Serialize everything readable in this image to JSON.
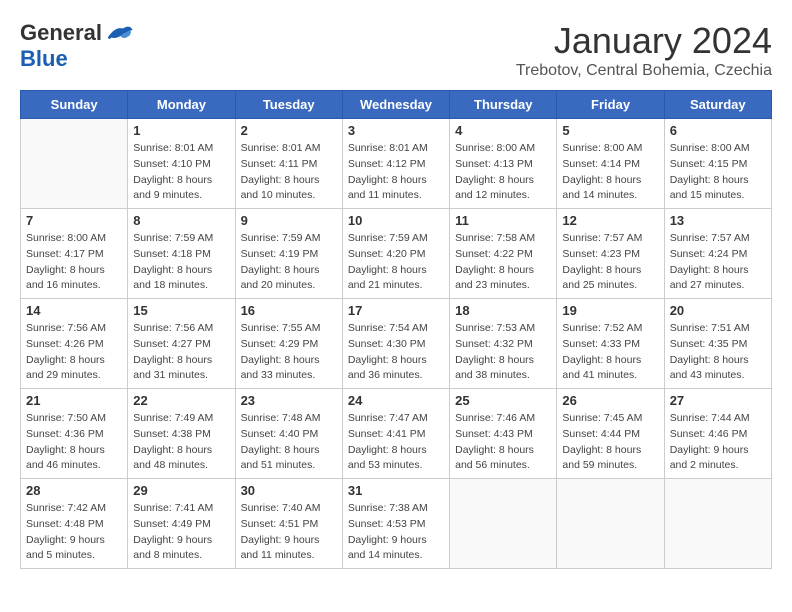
{
  "header": {
    "logo_general": "General",
    "logo_blue": "Blue",
    "month_title": "January 2024",
    "location": "Trebotov, Central Bohemia, Czechia"
  },
  "days_of_week": [
    "Sunday",
    "Monday",
    "Tuesday",
    "Wednesday",
    "Thursday",
    "Friday",
    "Saturday"
  ],
  "weeks": [
    [
      {
        "day": "",
        "info": ""
      },
      {
        "day": "1",
        "info": "Sunrise: 8:01 AM\nSunset: 4:10 PM\nDaylight: 8 hours\nand 9 minutes."
      },
      {
        "day": "2",
        "info": "Sunrise: 8:01 AM\nSunset: 4:11 PM\nDaylight: 8 hours\nand 10 minutes."
      },
      {
        "day": "3",
        "info": "Sunrise: 8:01 AM\nSunset: 4:12 PM\nDaylight: 8 hours\nand 11 minutes."
      },
      {
        "day": "4",
        "info": "Sunrise: 8:00 AM\nSunset: 4:13 PM\nDaylight: 8 hours\nand 12 minutes."
      },
      {
        "day": "5",
        "info": "Sunrise: 8:00 AM\nSunset: 4:14 PM\nDaylight: 8 hours\nand 14 minutes."
      },
      {
        "day": "6",
        "info": "Sunrise: 8:00 AM\nSunset: 4:15 PM\nDaylight: 8 hours\nand 15 minutes."
      }
    ],
    [
      {
        "day": "7",
        "info": ""
      },
      {
        "day": "8",
        "info": "Sunrise: 7:59 AM\nSunset: 4:18 PM\nDaylight: 8 hours\nand 18 minutes."
      },
      {
        "day": "9",
        "info": "Sunrise: 7:59 AM\nSunset: 4:19 PM\nDaylight: 8 hours\nand 20 minutes."
      },
      {
        "day": "10",
        "info": "Sunrise: 7:59 AM\nSunset: 4:20 PM\nDaylight: 8 hours\nand 21 minutes."
      },
      {
        "day": "11",
        "info": "Sunrise: 7:58 AM\nSunset: 4:22 PM\nDaylight: 8 hours\nand 23 minutes."
      },
      {
        "day": "12",
        "info": "Sunrise: 7:57 AM\nSunset: 4:23 PM\nDaylight: 8 hours\nand 25 minutes."
      },
      {
        "day": "13",
        "info": "Sunrise: 7:57 AM\nSunset: 4:24 PM\nDaylight: 8 hours\nand 27 minutes."
      }
    ],
    [
      {
        "day": "14",
        "info": ""
      },
      {
        "day": "15",
        "info": "Sunrise: 7:56 AM\nSunset: 4:27 PM\nDaylight: 8 hours\nand 31 minutes."
      },
      {
        "day": "16",
        "info": "Sunrise: 7:55 AM\nSunset: 4:29 PM\nDaylight: 8 hours\nand 33 minutes."
      },
      {
        "day": "17",
        "info": "Sunrise: 7:54 AM\nSunset: 4:30 PM\nDaylight: 8 hours\nand 36 minutes."
      },
      {
        "day": "18",
        "info": "Sunrise: 7:53 AM\nSunset: 4:32 PM\nDaylight: 8 hours\nand 38 minutes."
      },
      {
        "day": "19",
        "info": "Sunrise: 7:52 AM\nSunset: 4:33 PM\nDaylight: 8 hours\nand 41 minutes."
      },
      {
        "day": "20",
        "info": "Sunrise: 7:51 AM\nSunset: 4:35 PM\nDaylight: 8 hours\nand 43 minutes."
      }
    ],
    [
      {
        "day": "21",
        "info": ""
      },
      {
        "day": "22",
        "info": "Sunrise: 7:49 AM\nSunset: 4:38 PM\nDaylight: 8 hours\nand 48 minutes."
      },
      {
        "day": "23",
        "info": "Sunrise: 7:48 AM\nSunset: 4:40 PM\nDaylight: 8 hours\nand 51 minutes."
      },
      {
        "day": "24",
        "info": "Sunrise: 7:47 AM\nSunset: 4:41 PM\nDaylight: 8 hours\nand 53 minutes."
      },
      {
        "day": "25",
        "info": "Sunrise: 7:46 AM\nSunset: 4:43 PM\nDaylight: 8 hours\nand 56 minutes."
      },
      {
        "day": "26",
        "info": "Sunrise: 7:45 AM\nSunset: 4:44 PM\nDaylight: 8 hours\nand 59 minutes."
      },
      {
        "day": "27",
        "info": "Sunrise: 7:44 AM\nSunset: 4:46 PM\nDaylight: 9 hours\nand 2 minutes."
      }
    ],
    [
      {
        "day": "28",
        "info": ""
      },
      {
        "day": "29",
        "info": "Sunrise: 7:41 AM\nSunset: 4:49 PM\nDaylight: 9 hours\nand 8 minutes."
      },
      {
        "day": "30",
        "info": "Sunrise: 7:40 AM\nSunset: 4:51 PM\nDaylight: 9 hours\nand 11 minutes."
      },
      {
        "day": "31",
        "info": "Sunrise: 7:38 AM\nSunset: 4:53 PM\nDaylight: 9 hours\nand 14 minutes."
      },
      {
        "day": "",
        "info": ""
      },
      {
        "day": "",
        "info": ""
      },
      {
        "day": "",
        "info": ""
      }
    ]
  ],
  "week_sunday_info": [
    "Sunrise: 8:00 AM\nSunset: 4:17 PM\nDaylight: 8 hours\nand 16 minutes.",
    "Sunrise: 7:56 AM\nSunset: 4:26 PM\nDaylight: 8 hours\nand 29 minutes.",
    "Sunrise: 7:50 AM\nSunset: 4:36 PM\nDaylight: 8 hours\nand 46 minutes.",
    "Sunrise: 7:42 AM\nSunset: 4:48 PM\nDaylight: 9 hours\nand 5 minutes."
  ]
}
